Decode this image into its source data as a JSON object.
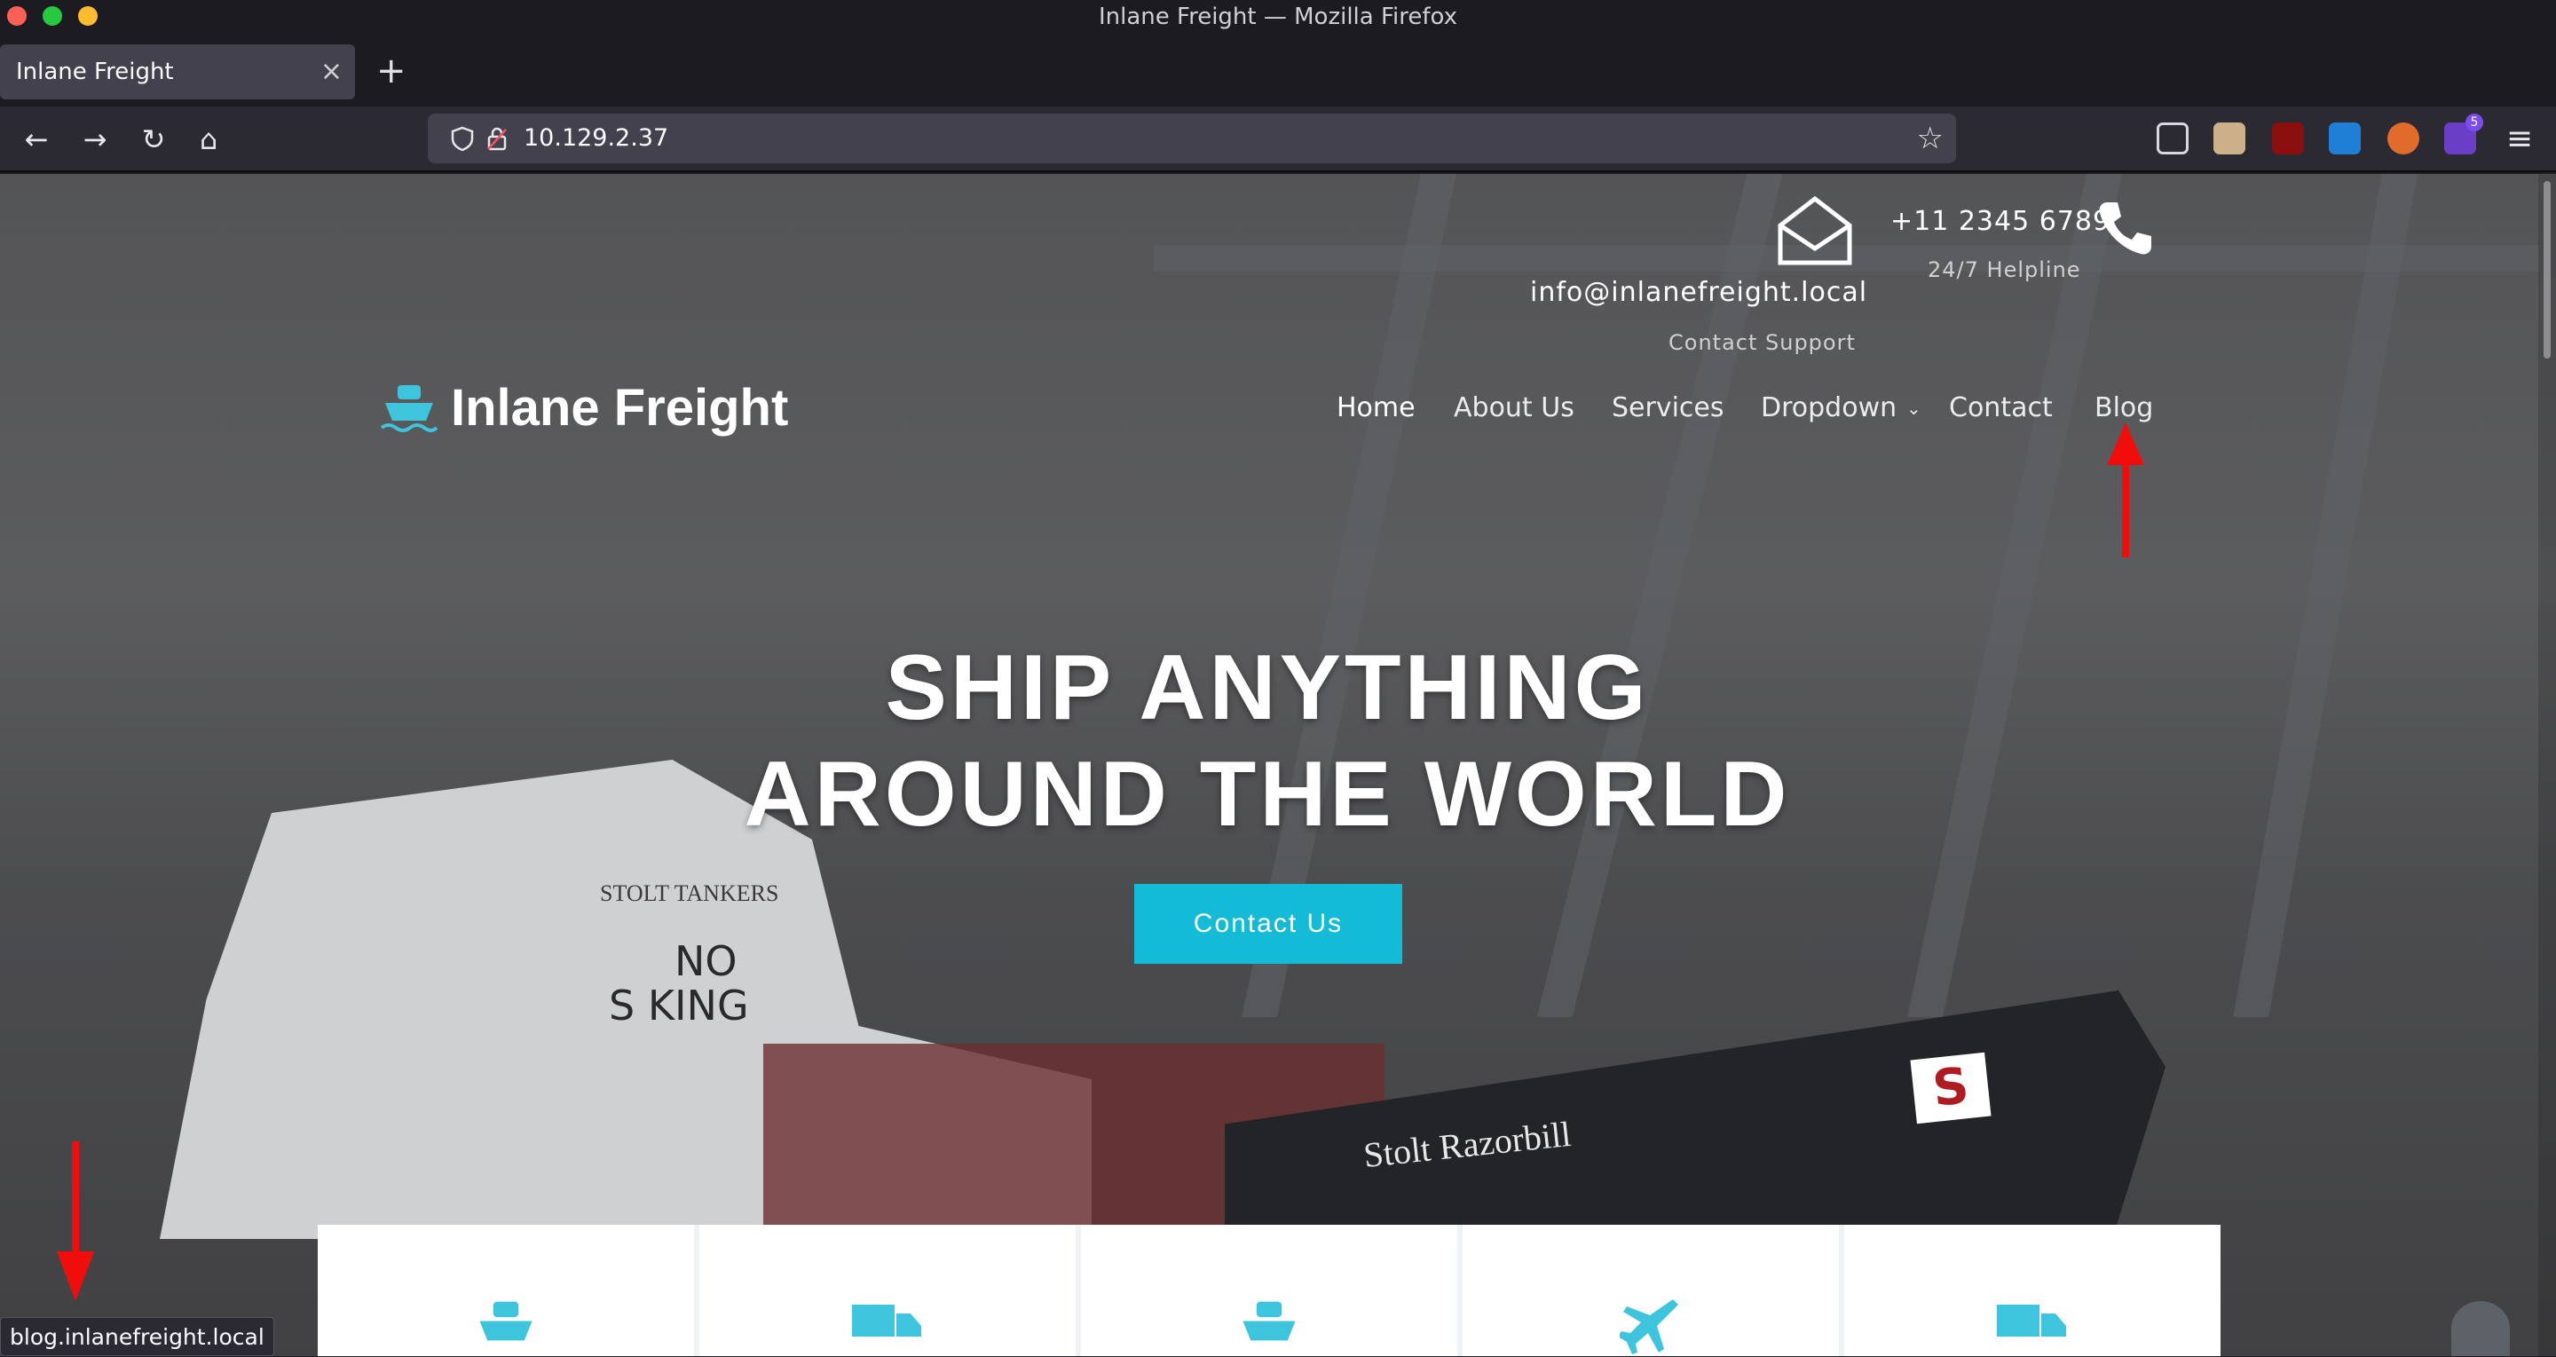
{
  "window": {
    "title": "Inlane Freight — Mozilla Firefox",
    "traffic_colors": {
      "close": "#ff5f57",
      "min": "#27c93f",
      "max": "#ffbd2e"
    }
  },
  "tabs": [
    {
      "label": "Inlane Freight",
      "close": "×"
    }
  ],
  "new_tab": "+",
  "nav": {
    "back": "←",
    "forward": "→",
    "reload": "↻",
    "home": "⌂"
  },
  "url": {
    "value": "10.129.2.37",
    "bookmark": "☆"
  },
  "extensions": {
    "badge_count": "5",
    "menu": "≡"
  },
  "site": {
    "email": "info@inlanefreight.local",
    "email_caption": "Contact Support",
    "phone": "+11 2345 6789",
    "phone_caption": "24/7 Helpline",
    "logo": "Inlane Freight",
    "menu": [
      "Home",
      "About Us",
      "Services",
      "Dropdown",
      "Contact",
      "Blog"
    ],
    "hero_line1": "SHIP ANYTHING",
    "hero_line2": "AROUND THE WORLD",
    "cta": "Contact Us",
    "ship_text_1": "STOLT TANKERS",
    "ship_text_2": "NO",
    "ship_text_3": "S  KING",
    "ship_text_4": "Stolt Razorbill",
    "ship_logo": "S"
  },
  "status_url": "blog.inlanefreight.local",
  "colors": {
    "accent": "#13bbd6",
    "arrow": "#f20d0d"
  }
}
